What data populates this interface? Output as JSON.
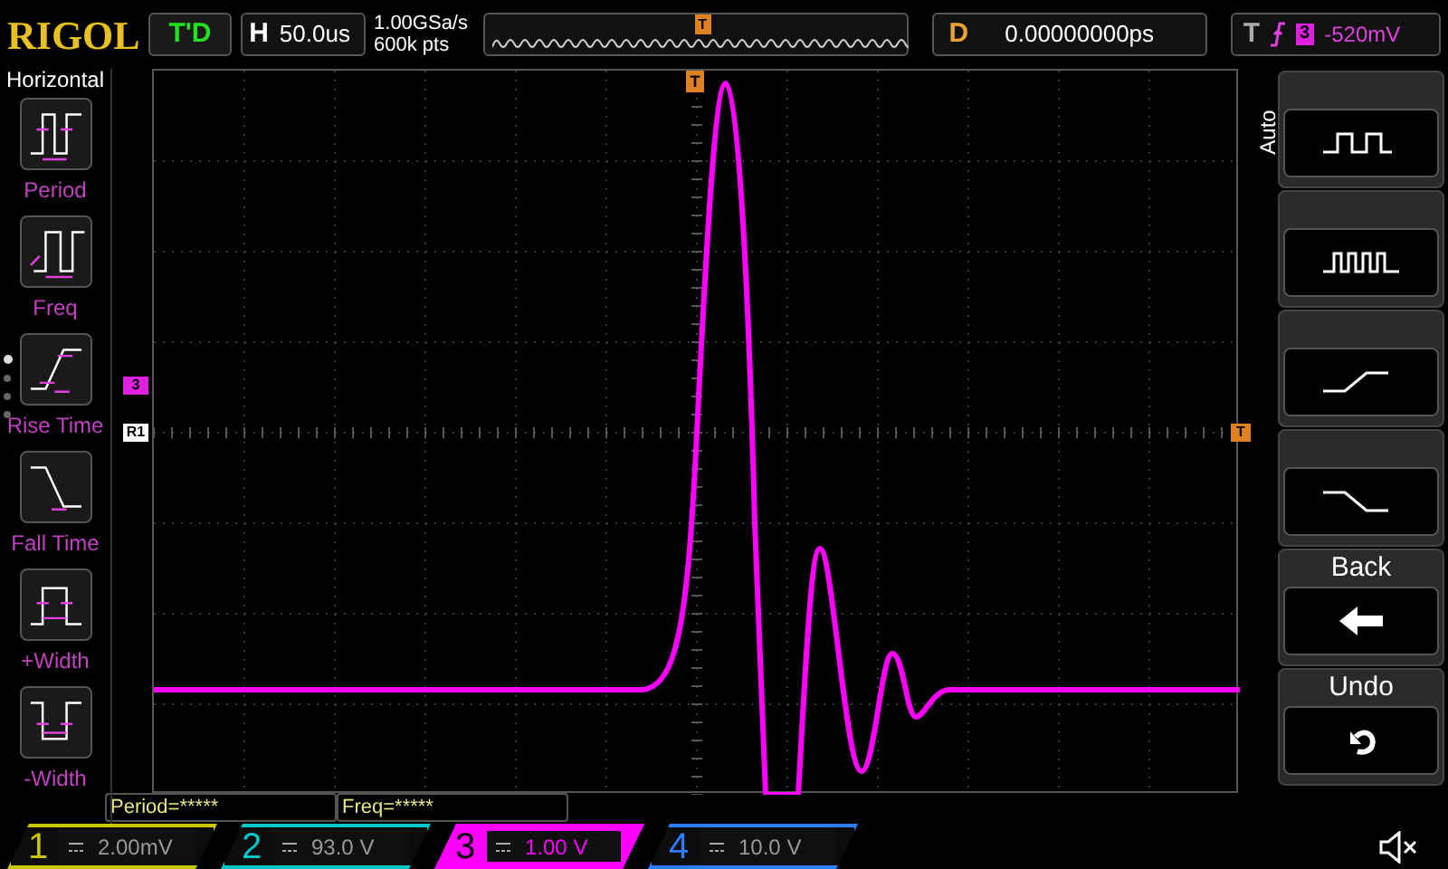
{
  "top_bar": {
    "logo": "RIGOL",
    "run_status": "T'D",
    "timebase": {
      "label": "H",
      "value": "50.0us"
    },
    "sample_rate": "1.00GSa/s",
    "memory_depth": "600k pts",
    "overview_trigger_marker": "T",
    "delay": {
      "label": "D",
      "value": "0.00000000ps"
    },
    "trigger": {
      "label": "T",
      "source": "3",
      "level": "-520mV"
    }
  },
  "left_menu": {
    "title": "Horizontal",
    "items": [
      {
        "label": "Period",
        "kind": "period"
      },
      {
        "label": "Freq",
        "kind": "freq"
      },
      {
        "label": "Rise Time",
        "kind": "rise"
      },
      {
        "label": "Fall Time",
        "kind": "fall"
      },
      {
        "label": "+Width",
        "kind": "pwidth"
      },
      {
        "label": "-Width",
        "kind": "nwidth"
      }
    ],
    "page_dots": [
      {
        "selected": true
      },
      {
        "selected": false
      },
      {
        "selected": false
      },
      {
        "selected": false
      }
    ]
  },
  "markers": {
    "trigger_position": "T",
    "channel": "3",
    "reference": "R1",
    "trigger_level": "T"
  },
  "measurements": [
    "Period=*****",
    "Freq=*****"
  ],
  "right_menu": {
    "title": "Auto",
    "items": [
      {
        "kind": "square"
      },
      {
        "kind": "pulse_train"
      },
      {
        "kind": "rise"
      },
      {
        "kind": "fall"
      },
      {
        "label": "Back",
        "kind": "back"
      },
      {
        "label": "Undo",
        "kind": "undo"
      }
    ]
  },
  "channels": [
    {
      "number": "1",
      "scale": "2.00mV",
      "selected": false,
      "color": "#c8c800"
    },
    {
      "number": "2",
      "scale": "93.0 V",
      "selected": false,
      "color": "#00c8c8"
    },
    {
      "number": "3",
      "scale": "1.00 V",
      "selected": true,
      "color": "#ff00ff"
    },
    {
      "number": "4",
      "scale": "10.0 V",
      "selected": false,
      "color": "#2a7fff"
    }
  ]
}
